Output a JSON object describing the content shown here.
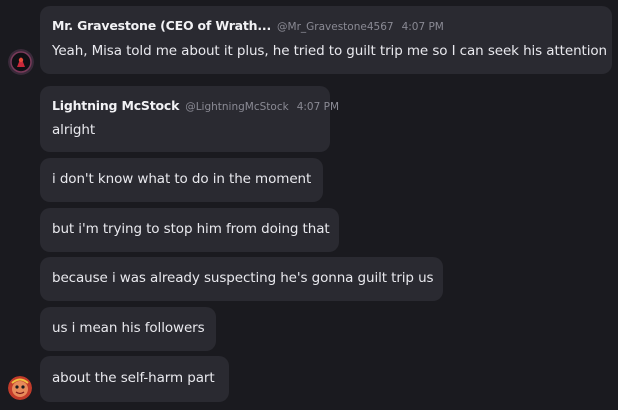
{
  "messages": [
    {
      "author": "Mr. Gravestone (CEO of Wrath...",
      "handle": "@Mr_Gravestone4567",
      "time": "4:07 PM",
      "text": "Yeah, Misa told me about it plus, he tried to guilt trip me so I can seek his attention"
    },
    {
      "author": "Lightning McStock",
      "handle": "@LightningMcStock",
      "time": "4:07 PM",
      "text": "alright"
    },
    {
      "text": "i don't know what to do in the moment"
    },
    {
      "text": "but i'm trying to stop him from doing that"
    },
    {
      "text": "because i was already suspecting he's gonna guilt trip us"
    },
    {
      "text": "us i mean his followers"
    },
    {
      "text": "about the self-harm part"
    }
  ],
  "colors": {
    "background": "#1a1a1f",
    "bubble": "#2a2a31",
    "text": "#e9e9ee",
    "meta": "#8a8a94"
  },
  "icons": {
    "avatar_1": "dark-circle-red-figure-avatar",
    "avatar_2": "red-orange-face-avatar"
  }
}
